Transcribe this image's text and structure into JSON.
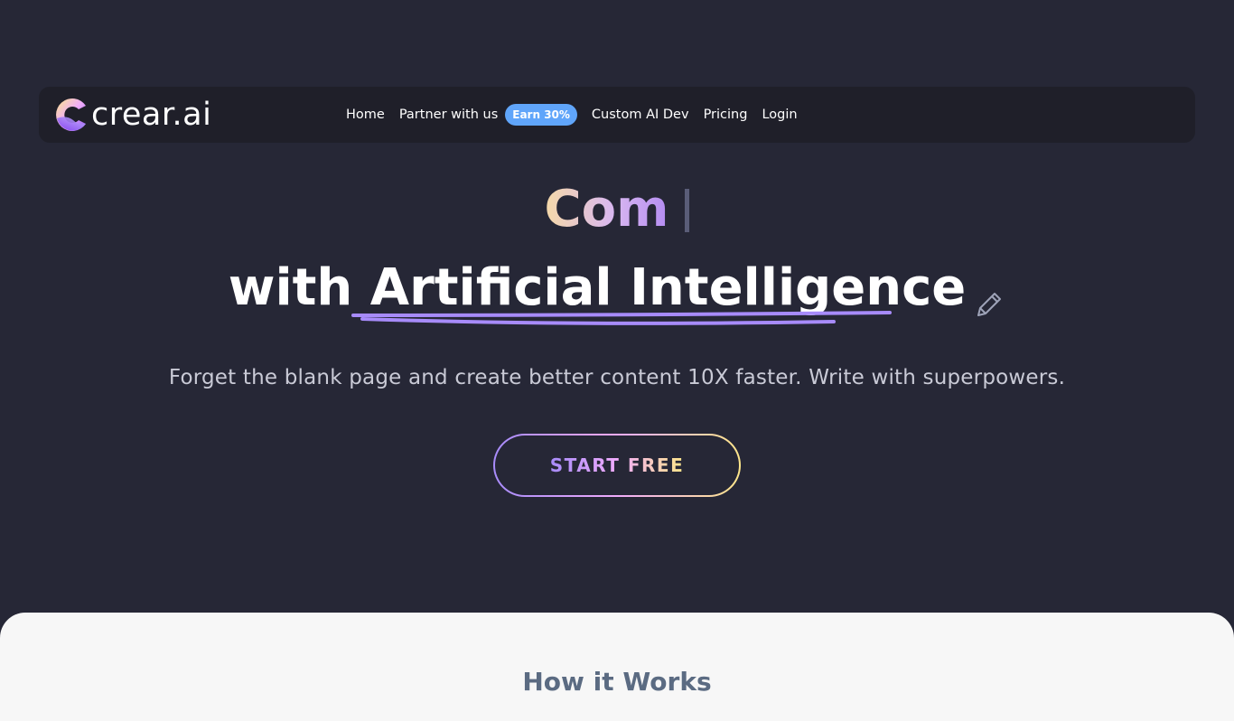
{
  "nav": {
    "logo_text": "crear.ai",
    "items": [
      {
        "label": "Home"
      },
      {
        "label": "Partner with us"
      },
      {
        "label": "Custom AI Dev"
      },
      {
        "label": "Pricing"
      },
      {
        "label": "Login"
      }
    ],
    "badge": "Earn 30%"
  },
  "hero": {
    "typed_text": "Com",
    "prefix": "with ",
    "highlight": "Artificial Intelligence",
    "subtitle": "Forget the blank page and create better content 10X faster. Write with superpowers.",
    "cta_label": "START FREE"
  },
  "how": {
    "title": "How it Works"
  },
  "colors": {
    "background": "#262736",
    "navbar": "#1f1f29",
    "badge": "#60a5fa",
    "underline": "#a78bfa",
    "section_bg": "#f7f7f7"
  },
  "icons": {
    "logo": "crear-logo-icon",
    "pencil": "pencil-icon"
  }
}
